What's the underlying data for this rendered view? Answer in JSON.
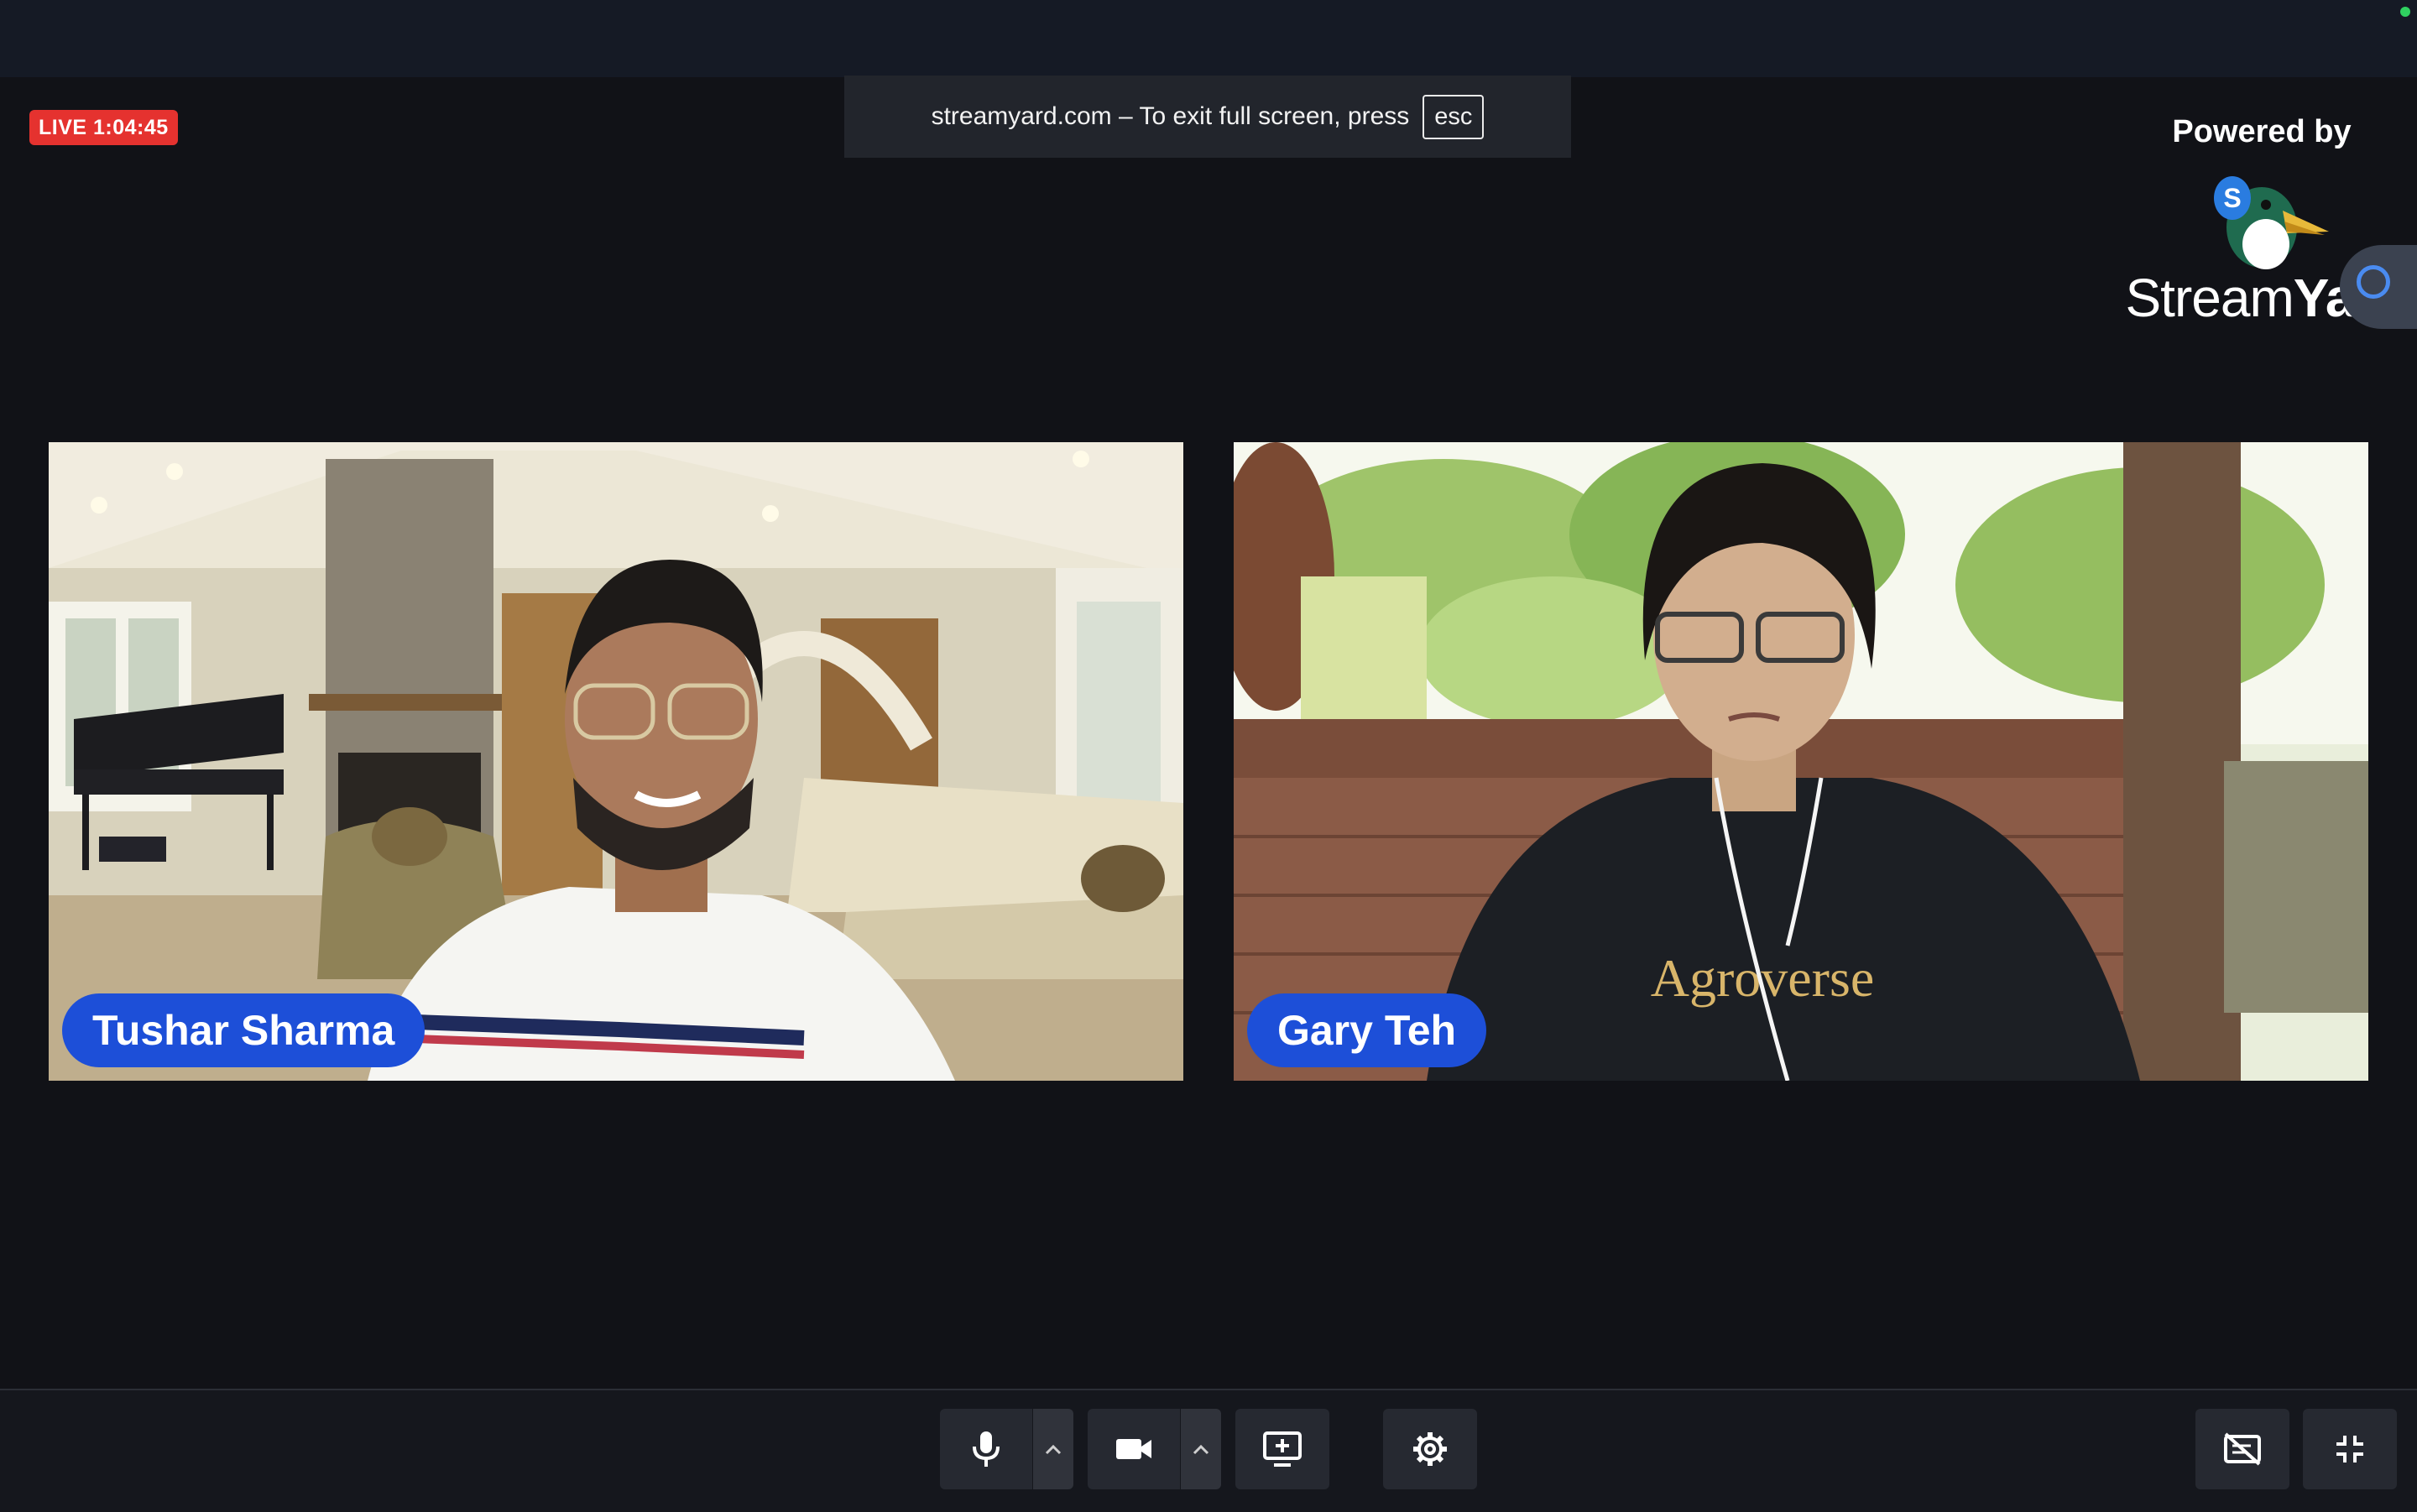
{
  "live_badge": "LIVE 1:04:45",
  "fullscreen_notice": {
    "message": "streamyard.com – To exit full screen, press",
    "key": "esc"
  },
  "branding": {
    "powered_by": "Powered by",
    "name_regular": "Stream",
    "name_bold": "Yard",
    "logo_letter": "S"
  },
  "participants": [
    {
      "name": "Tushar Sharma"
    },
    {
      "name": "Gary Teh"
    }
  ],
  "toolbar": {
    "buttons": [
      {
        "icon": "microphone-icon"
      },
      {
        "icon": "chevron-up-icon"
      },
      {
        "icon": "camera-icon"
      },
      {
        "icon": "chevron-up-icon"
      },
      {
        "icon": "share-screen-icon"
      },
      {
        "icon": "gear-icon"
      },
      {
        "icon": "hide-captions-icon"
      },
      {
        "icon": "exit-fullscreen-icon"
      }
    ]
  },
  "colors": {
    "live_red": "#e5322f",
    "name_tag_blue": "#1d4fd8",
    "background": "#111217"
  }
}
